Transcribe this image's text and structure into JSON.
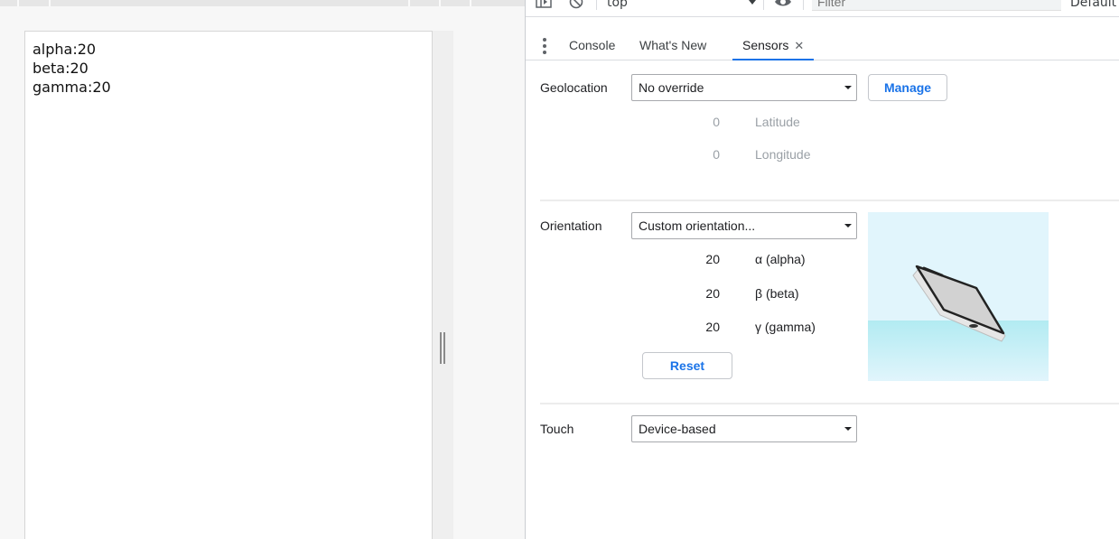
{
  "page": {
    "lines": [
      "alpha:20",
      "beta:20",
      "gamma:20"
    ]
  },
  "toolbar": {
    "context": "top",
    "filter_placeholder": "Filter",
    "levels": "Default levels"
  },
  "drawer": {
    "tabs": [
      {
        "label": "Console"
      },
      {
        "label": "What's New"
      },
      {
        "label": "Sensors",
        "close": "✕"
      }
    ]
  },
  "sensors": {
    "geolocation": {
      "label": "Geolocation",
      "selected": "No override",
      "manage_label": "Manage",
      "latitude_value": "0",
      "latitude_label": "Latitude",
      "longitude_value": "0",
      "longitude_label": "Longitude"
    },
    "orientation": {
      "label": "Orientation",
      "selected": "Custom orientation...",
      "alpha_value": "20",
      "alpha_label": "α (alpha)",
      "beta_value": "20",
      "beta_label": "β (beta)",
      "gamma_value": "20",
      "gamma_label": "γ (gamma)",
      "reset_label": "Reset"
    },
    "touch": {
      "label": "Touch",
      "selected": "Device-based"
    }
  },
  "colors": {
    "accent": "#1a73e8",
    "sky": "#e1f5fc",
    "floor": "#b2ebf2"
  }
}
